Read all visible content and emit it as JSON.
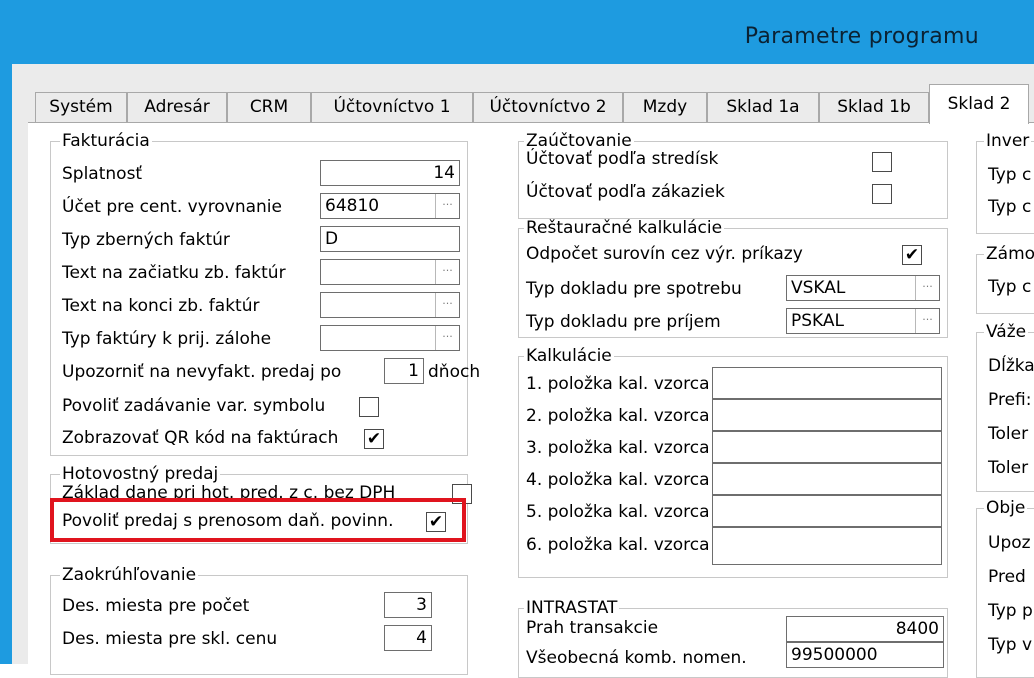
{
  "window": {
    "title": "Parametre programu"
  },
  "tabs": [
    "Systém",
    "Adresár",
    "CRM",
    "Účtovníctvo 1",
    "Účtovníctvo 2",
    "Mzdy",
    "Sklad 1a",
    "Sklad 1b",
    "Sklad 2"
  ],
  "fakturacia": {
    "title": "Fakturácia",
    "splatnost": {
      "label": "Splatnosť",
      "value": "14"
    },
    "ucet": {
      "label": "Účet pre cent. vyrovnanie",
      "value": "64810"
    },
    "typ_zbernych": {
      "label": "Typ zberných faktúr",
      "value": "D"
    },
    "text_zaciatok": {
      "label": "Text na začiatku zb. faktúr",
      "value": ""
    },
    "text_koniec": {
      "label": "Text na konci zb. faktúr",
      "value": ""
    },
    "typ_faktury": {
      "label": "Typ faktúry k prij. zálohe",
      "value": ""
    },
    "upozornit": {
      "label": "Upozorniť na nevyfakt. predaj po",
      "value": "1",
      "suffix": "dňoch"
    },
    "povolit_var": {
      "label": "Povoliť zadávanie var. symbolu",
      "checked": ""
    },
    "zobrazovat_qr": {
      "label": "Zobrazovať QR kód na faktúrach",
      "checked": "✔"
    }
  },
  "hotovostny": {
    "title": "Hotovostný predaj",
    "zaklad": {
      "label": "Základ dane pri hot. pred. z c. bez DPH",
      "checked": ""
    },
    "povolit_prenos": {
      "label": "Povoliť predaj s prenosom daň. povinn.",
      "checked": "✔"
    }
  },
  "zaokruhlovanie": {
    "title": "Zaokrúhľovanie",
    "pocet": {
      "label": "Des. miesta pre počet",
      "value": "3"
    },
    "skl_cenu": {
      "label": "Des. miesta pre skl. cenu",
      "value": "4"
    }
  },
  "zauctovanie": {
    "title": "Zaúčtovanie",
    "strediska": {
      "label": "Účtovať podľa stredísk",
      "checked": ""
    },
    "zakazky": {
      "label": "Účtovať podľa zákaziek",
      "checked": ""
    }
  },
  "restauracne": {
    "title": "Reštauračné kalkulácie",
    "odpocet": {
      "label": "Odpočet surovín cez výr. príkazy",
      "checked": "✔"
    },
    "spotreba": {
      "label": "Typ dokladu pre spotrebu",
      "value": "VSKAL"
    },
    "prijem": {
      "label": "Typ dokladu pre príjem",
      "value": "PSKAL"
    }
  },
  "kalkulacie": {
    "title": "Kalkulácie",
    "items": [
      {
        "label": "1. položka kal. vzorca",
        "value": ""
      },
      {
        "label": "2. položka kal. vzorca",
        "value": ""
      },
      {
        "label": "3. položka kal. vzorca",
        "value": ""
      },
      {
        "label": "4. položka kal. vzorca",
        "value": ""
      },
      {
        "label": "5. položka kal. vzorca",
        "value": ""
      },
      {
        "label": "6. položka kal. vzorca",
        "value": ""
      }
    ]
  },
  "intrastat": {
    "title": "INTRASTAT",
    "prah": {
      "label": "Prah transakcie",
      "value": "8400"
    },
    "vseobecna": {
      "label": "Všeobecná komb. nomen.",
      "value": "99500000"
    }
  },
  "right_col": {
    "g1_title": "Inver",
    "g1_l1": "Typ c",
    "g1_l2": "Typ c",
    "g2_title": "Zámo",
    "g2_l1": "Typ c",
    "g3_title": "Váže",
    "g3_l1": "Dĺžka",
    "g3_l2": "Prefi:",
    "g3_l3": "Toler",
    "g3_l4": "Toler",
    "g4_title": "Obje",
    "g4_l1": "Upoz",
    "g4_l2": "Pred",
    "g4_l3": "Typ p",
    "g4_l4": "Typ v"
  }
}
